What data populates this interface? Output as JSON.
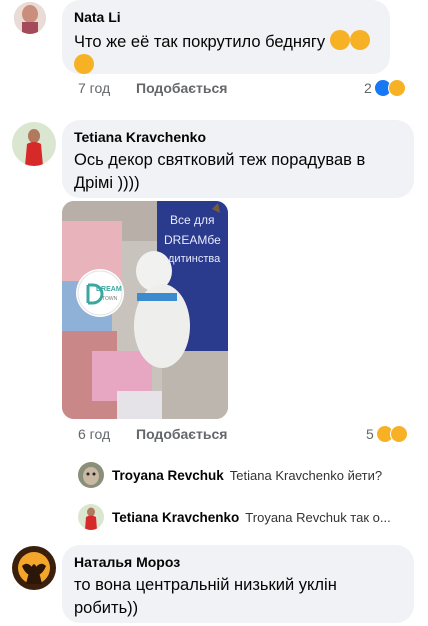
{
  "comments": [
    {
      "author": "Nata Li",
      "text": "Что же её так покрутило беднягу",
      "time": "7 год",
      "like_label": "Подобається",
      "reaction_count": "2"
    },
    {
      "author": "Tetiana Kravchenko",
      "text_line1": "Ось декор святковий теж порадував в",
      "text_line2": "Дрімі ))))",
      "time": "6 год",
      "like_label": "Подобається",
      "reaction_count": "5",
      "photo": {
        "banner_line1": "Все для",
        "banner_line2": "DREAMбе",
        "banner_line3": "дитинства",
        "logo_text": "DREAM",
        "logo_sub": "TOWN"
      }
    },
    {
      "author": "Наталья Мороз",
      "text_line1": "то вона центральній низький уклін",
      "text_line2": "робить))"
    }
  ],
  "replies": [
    {
      "author": "Troyana Revchuk",
      "text": "Tetiana Kravchenko йети?"
    },
    {
      "author": "Tetiana Kravchenko",
      "text": "Troyana Revchuk так о..."
    }
  ],
  "colors": {
    "bubble": "#f0f2f5",
    "meta": "#65676b",
    "like_blue": "#1877f2",
    "emoji_yellow": "#f7b125",
    "banner_blue": "#2a3a8c"
  }
}
